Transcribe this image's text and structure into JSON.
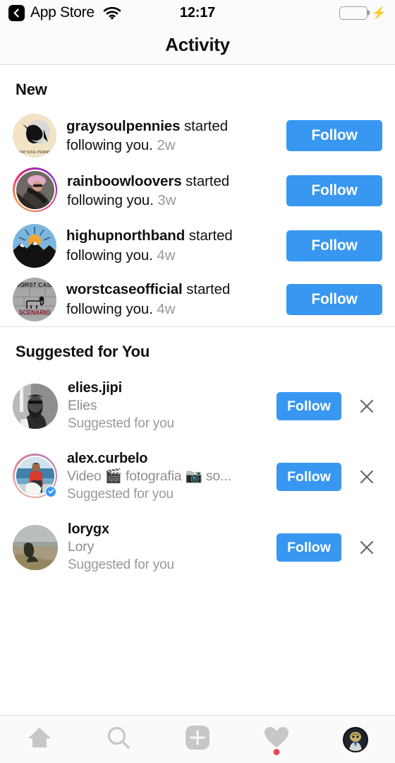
{
  "status_bar": {
    "back_label": "App Store",
    "back_icon": "back-chevron-icon",
    "wifi_icon": "wifi-icon",
    "time": "12:17",
    "battery_icon": "battery-full-icon",
    "charging_icon": "lightning-bolt-icon",
    "battery_color": "#4cd964"
  },
  "nav": {
    "title": "Activity"
  },
  "sections": {
    "new": {
      "header": "New",
      "items": [
        {
          "username": "graysoulpennies",
          "action": " started following you. ",
          "timestamp": "2w",
          "button_label": "Follow",
          "avatar": "graysoulpennies-avatar",
          "has_story_ring": false
        },
        {
          "username": "rainboowloovers",
          "action": " started following you. ",
          "timestamp": "3w",
          "button_label": "Follow",
          "avatar": "rainboowloovers-avatar",
          "has_story_ring": true
        },
        {
          "username": "highupnorthband",
          "action": " started following you. ",
          "timestamp": "4w",
          "button_label": "Follow",
          "avatar": "highupnorthband-avatar",
          "has_story_ring": false
        },
        {
          "username": "worstcaseofficial",
          "action": " started following you. ",
          "timestamp": "4w",
          "button_label": "Follow",
          "avatar": "worstcaseofficial-avatar",
          "has_story_ring": false
        }
      ]
    },
    "suggested": {
      "header": "Suggested for You",
      "items": [
        {
          "username": "elies.jipi",
          "subtitle": "Elies",
          "note": "Suggested for you",
          "button_label": "Follow",
          "dismiss_icon": "close-icon",
          "avatar": "elies-jipi-avatar",
          "verified": false
        },
        {
          "username": "alex.curbelo",
          "subtitle": "Video 🎬 fotografia 📷 so...",
          "note": "Suggested for you",
          "button_label": "Follow",
          "dismiss_icon": "close-icon",
          "avatar": "alex-curbelo-avatar",
          "verified": true
        },
        {
          "username": "lorygx",
          "subtitle": "Lory",
          "note": "Suggested for you",
          "button_label": "Follow",
          "dismiss_icon": "close-icon",
          "avatar": "lorygx-avatar",
          "verified": false
        }
      ]
    }
  },
  "tab_bar": {
    "items": [
      {
        "name": "home",
        "icon": "home-icon",
        "active": false
      },
      {
        "name": "search",
        "icon": "search-icon",
        "active": false
      },
      {
        "name": "add",
        "icon": "add-plus-icon",
        "active": false
      },
      {
        "name": "activity",
        "icon": "heart-icon",
        "active": true,
        "badge": true
      },
      {
        "name": "profile",
        "icon": "profile-avatar-icon",
        "active": true
      }
    ]
  },
  "colors": {
    "accent_blue": "#3897f0",
    "badge_red": "#ed4956",
    "muted_text": "#8e8e8e"
  }
}
